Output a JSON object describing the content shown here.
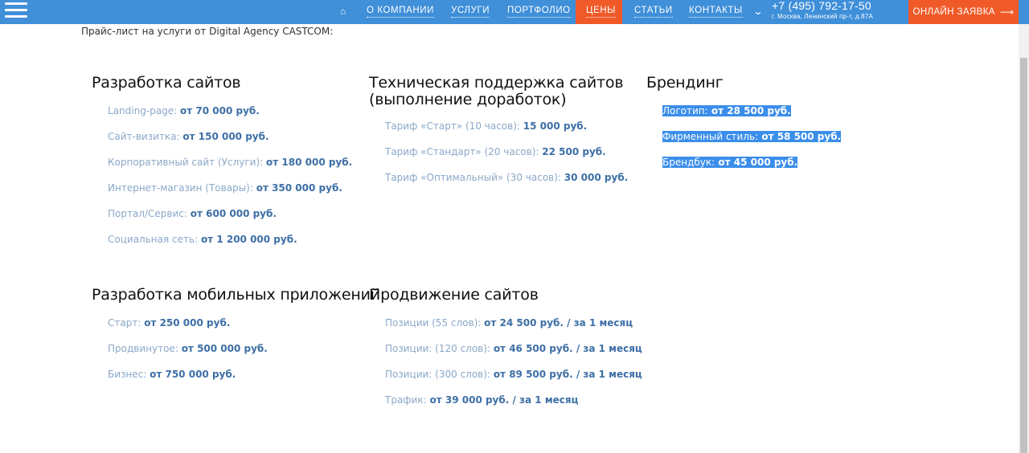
{
  "nav": {
    "home_icon": "home-icon",
    "links": [
      "О КОМПАНИИ",
      "УСЛУГИ",
      "ПОРТФОЛИО",
      "ЦЕНЫ",
      "СТАТЬИ",
      "КОНТАКТЫ"
    ],
    "active": "ЦЕНЫ",
    "phone": "+7 (495) 792-17-50",
    "address": "г. Москва, Ленинский пр-т, д.87А",
    "cta": "ОНЛАЙН ЗАЯВКА",
    "colors": {
      "bar": "#3f8fd9",
      "accent": "#f05a28"
    }
  },
  "intro": "Прайс-лист на услуги от Digital Agency CASTCOM:",
  "sections": {
    "web": {
      "title": "Разработка сайтов",
      "items": [
        {
          "label": "Landing-page:",
          "price": "от 70 000 руб."
        },
        {
          "label": "Сайт-визитка:",
          "price": "от 150 000 руб."
        },
        {
          "label": "Корпоративный сайт (Услуги):",
          "price": "от 180 000 руб."
        },
        {
          "label": "Интернет-магазин (Товары):",
          "price": "от 350 000 руб."
        },
        {
          "label": "Портал/Сервис:",
          "price": "от 600 000 руб."
        },
        {
          "label": "Социальная сеть:",
          "price": "от 1 200 000 руб."
        }
      ]
    },
    "support": {
      "title_line1": "Техническая поддержка сайтов",
      "title_line2": "(выполнение доработок)",
      "items": [
        {
          "label": "Тариф «Старт» (10 часов):",
          "price": "15 000 руб."
        },
        {
          "label": "Тариф «Стандарт» (20 часов):",
          "price": "22 500 руб."
        },
        {
          "label": "Тариф «Оптимальный» (30 часов):",
          "price": "30 000 руб."
        }
      ]
    },
    "branding": {
      "title": "Брендинг",
      "items": [
        {
          "label": "Логотип:",
          "price": "от 28 500 руб."
        },
        {
          "label": "Фирменный стиль:",
          "price": "от 58 500 руб."
        },
        {
          "label": "Брендбук:",
          "price": "от 45 000 руб."
        }
      ]
    },
    "mobile": {
      "title": "Разработка мобильных приложений",
      "items": [
        {
          "label": "Старт:",
          "price": "от 250 000 руб."
        },
        {
          "label": "Продвинутое:",
          "price": "от 500 000 руб."
        },
        {
          "label": "Бизнес:",
          "price": "от 750 000 руб."
        }
      ]
    },
    "seo": {
      "title": "Продвижение сайтов",
      "items": [
        {
          "label": "Позиции (55 слов):",
          "price": "от 24 500 руб. / за 1 месяц"
        },
        {
          "label": "Позиции: (120 слов):",
          "price": "от 46 500 руб. / за 1 месяц"
        },
        {
          "label": "Позиции: (300 слов):",
          "price": "от 89 500 руб. / за 1 месяц"
        },
        {
          "label": "Трафик:",
          "price": "от 39 000 руб. / за 1 месяц"
        }
      ]
    }
  }
}
